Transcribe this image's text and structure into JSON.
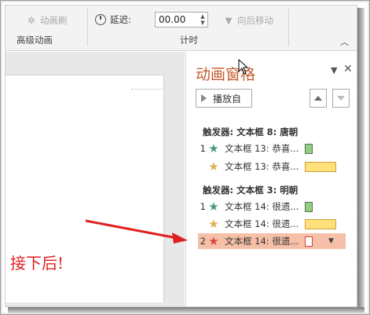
{
  "ribbon": {
    "animation_painter": "动画刷",
    "delay_label": "延迟:",
    "delay_value": "00.00",
    "move_later": "向后移动",
    "group_advanced": "高级动画",
    "group_timing": "计时"
  },
  "pane": {
    "title": "动画窗格",
    "play_label": "播放自",
    "groups": [
      {
        "trigger": "触发器: 文本框 8: 唐朝",
        "items": [
          {
            "num": "1",
            "star_color": "#4a9a78",
            "text": "文本框 13: 恭喜...",
            "bar": "green"
          },
          {
            "num": "",
            "star_color": "#e0b050",
            "text": "文本框 13: 恭喜...",
            "bar": "yellow"
          }
        ]
      },
      {
        "trigger": "触发器: 文本框 3: 明朝",
        "items": [
          {
            "num": "1",
            "star_color": "#4a9a78",
            "text": "文本框 14: 很遗...",
            "bar": "green"
          },
          {
            "num": "",
            "star_color": "#e0b050",
            "text": "文本框 14: 很遗...",
            "bar": "yellow"
          },
          {
            "num": "2",
            "star_color": "#d3473a",
            "text": "文本框 14: 很遗...",
            "bar": "red",
            "selected": true
          }
        ]
      }
    ]
  },
  "slide": {
    "visible_text": "接下后!"
  },
  "colors": {
    "pane_title": "#c3592b",
    "selection": "#f6c0a8",
    "arrow": "#e02020"
  }
}
